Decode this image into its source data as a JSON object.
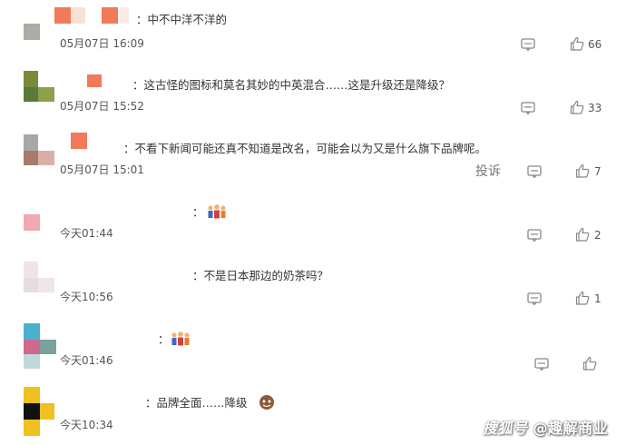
{
  "colors": {
    "text": "#333333",
    "muted": "#555555",
    "icon": "#888888"
  },
  "comments": [
    {
      "text": "：中不中洋不洋的",
      "time": "05月07日 16:09",
      "likes": "66"
    },
    {
      "text": "：这古怪的图标和莫名其妙的中英混合……这是升级还是降级？",
      "time": "05月07日 15:52",
      "likes": "33"
    },
    {
      "text": "：不看下新闻可能还真不知道是改名，可能会以为又是什么旗下品牌呢。",
      "time": "05月07日 15:01",
      "likes": "7",
      "report": "投诉"
    },
    {
      "text": "：",
      "time": "今天01:44",
      "likes": "2",
      "emoji": "family-emoji"
    },
    {
      "text": "：不是日本那边的奶茶吗？",
      "time": "今天10:56",
      "likes": "1"
    },
    {
      "text": "：",
      "time": "今天01:46",
      "likes": "",
      "emoji": "family-emoji"
    },
    {
      "text": "：品牌全面……降级",
      "time": "今天10:34",
      "likes": "",
      "emoji": "face-emoji"
    }
  ],
  "icons": {
    "reply": "comment-icon",
    "like": "thumbs-up-icon"
  },
  "watermark": {
    "prefix": "搜狐号",
    "text": "@趣解商业"
  }
}
